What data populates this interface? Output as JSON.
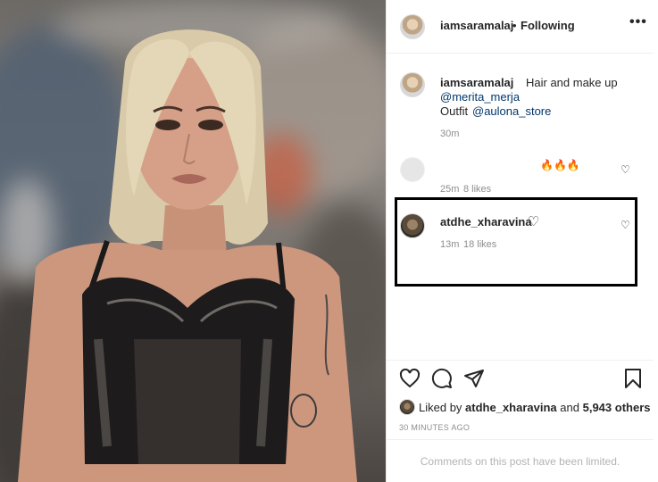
{
  "header": {
    "username": "iamsaramalaj",
    "separator": "•",
    "follow_status": "Following",
    "more_icon": "more-horizontal-icon",
    "more_label": "•••"
  },
  "caption": {
    "username": "iamsaramalaj",
    "text_line1": "Hair and make up",
    "mention1": "@merita_merja",
    "text_line3_prefix": "Outfit",
    "mention2": "@aulona_store",
    "time": "30m"
  },
  "comments": [
    {
      "emoji": "🔥🔥🔥",
      "time": "25m",
      "likes": "8 likes"
    },
    {
      "username": "atdhe_xharavina",
      "text": "♡",
      "time": "13m",
      "likes": "18 likes"
    }
  ],
  "actions": {
    "like_icon": "heart-icon",
    "comment_icon": "comment-icon",
    "share_icon": "send-icon",
    "save_icon": "bookmark-icon"
  },
  "likes": {
    "prefix": "Liked by",
    "user": "atdhe_xharavina",
    "middle": "and",
    "others": "5,943 others"
  },
  "post_time": "30 MINUTES AGO",
  "comments_limited": "Comments on this post have been limited.",
  "colors": {
    "text": "#262626",
    "muted": "#8e8e8e",
    "link": "#00376b",
    "highlight": "#000000"
  }
}
